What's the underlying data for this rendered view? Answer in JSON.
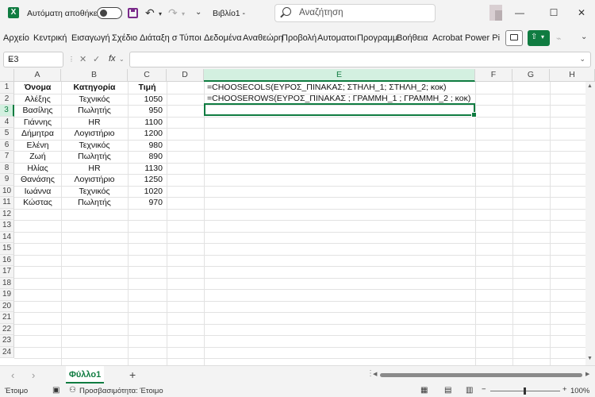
{
  "titlebar": {
    "autosave_label": "Αυτόματη αποθήκευση",
    "autosave_state": "off",
    "doc_title": "Βιβλίο1  -",
    "search_placeholder": "Αναζήτηση",
    "undo": "↶",
    "redo": "↷",
    "minimize": "—",
    "maximize": "☐",
    "close": "✕"
  },
  "ribbon": {
    "tabs": [
      "Αρχείο",
      "Κεντρική",
      "Εισαγωγή",
      "Σχέδιο",
      "Διάταξη σ",
      "Τύποι",
      "Δεδομένα",
      "Αναθεώρη",
      "Προβολή",
      "Αυτοματοι",
      "Προγραμμ",
      "Βοήθεια",
      "Acrobat",
      "Power Pivo"
    ]
  },
  "formula_bar": {
    "name_box": "E3",
    "cancel": "✕",
    "enter": "✓",
    "fx": "fx",
    "value": ""
  },
  "sheet": {
    "columns": [
      "A",
      "B",
      "C",
      "D",
      "E",
      "F",
      "G",
      "H"
    ],
    "selected_column": "E",
    "selected_row": 3,
    "selected_cell": "E3",
    "rows": [
      "1",
      "2",
      "3",
      "4",
      "5",
      "6",
      "7",
      "8",
      "9",
      "10",
      "11",
      "12",
      "13",
      "14",
      "15",
      "16",
      "17",
      "18",
      "19",
      "20",
      "21",
      "22",
      "23",
      "24"
    ],
    "headers": [
      "Όνομα",
      "Κατηγορία",
      "Τιμή"
    ],
    "data": [
      [
        "Αλέξης",
        "Τεχνικός",
        "1050"
      ],
      [
        "Βασίλης",
        "Πωλητής",
        "950"
      ],
      [
        "Γιάννης",
        "HR",
        "1100"
      ],
      [
        "Δήμητρα",
        "Λογιστήριο",
        "1200"
      ],
      [
        "Ελένη",
        "Τεχνικός",
        "980"
      ],
      [
        "Ζωή",
        "Πωλητής",
        "890"
      ],
      [
        "Ηλίας",
        "HR",
        "1130"
      ],
      [
        "Θανάσης",
        "Λογιστήριο",
        "1250"
      ],
      [
        "Ιωάννα",
        "Τεχνικός",
        "1020"
      ],
      [
        "Κώστας",
        "Πωλητής",
        "970"
      ]
    ],
    "e1": "=CHOOSECOLS(ΕΥΡΟΣ_ΠΙΝΑΚΑΣ; ΣΤΗΛΗ_1; ΣΤΗΛΗ_2; κοκ)",
    "e2": "=CHOOSEROWS(ΕΥΡΟΣ_ΠΙΝΑΚΑΣ ; ΓΡΑΜΜΗ_1 ; ΓΡΑΜΜΗ_2 ; κοκ)"
  },
  "sheetbar": {
    "sheet_tab": "Φύλλο1",
    "add_sheet": "+",
    "prev": "‹",
    "next": "›"
  },
  "status": {
    "ready": "Έτοιμο",
    "accessibility": "Προσβασιμότητα: Έτοιμο",
    "zoom": "100%",
    "zoom_minus": "−",
    "zoom_plus": "+",
    "zoom_level": 0.5
  },
  "colors": {
    "accent": "#107c41",
    "selection_header": "#d3f0e0"
  }
}
